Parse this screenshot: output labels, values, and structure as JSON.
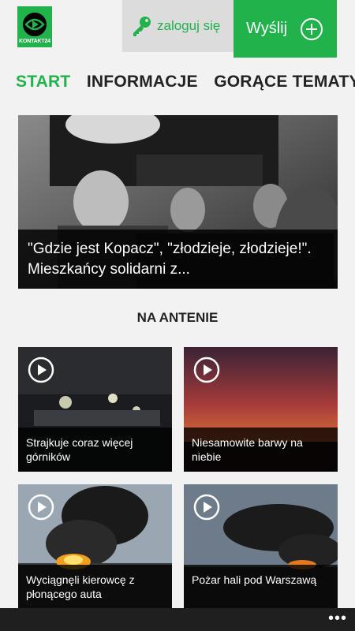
{
  "header": {
    "logo_text": "KONTAKT24",
    "login_label": "zaloguj się",
    "send_label": "Wyślij",
    "accent_color": "#21b24b"
  },
  "tabs": [
    {
      "label": "START",
      "active": true
    },
    {
      "label": "INFORMACJE",
      "active": false
    },
    {
      "label": "GORĄCE TEMATY",
      "active": false
    }
  ],
  "hero": {
    "caption": "\"Gdzie jest Kopacz\", \"złodzieje, złodzieje!\". Mieszkańcy solidarni z..."
  },
  "section": {
    "title": "NA ANTENIE"
  },
  "tiles": [
    {
      "caption": "Strajkuje coraz więcej górników",
      "icon": "play-icon"
    },
    {
      "caption": "Niesamowite barwy na niebie",
      "icon": "play-icon"
    },
    {
      "caption": "Wyciągnęli kierowcę z płonącego auta",
      "icon": "play-icon"
    },
    {
      "caption": "Pożar hali pod Warszawą",
      "icon": "play-icon"
    }
  ],
  "appbar": {
    "more_label": "•••"
  }
}
